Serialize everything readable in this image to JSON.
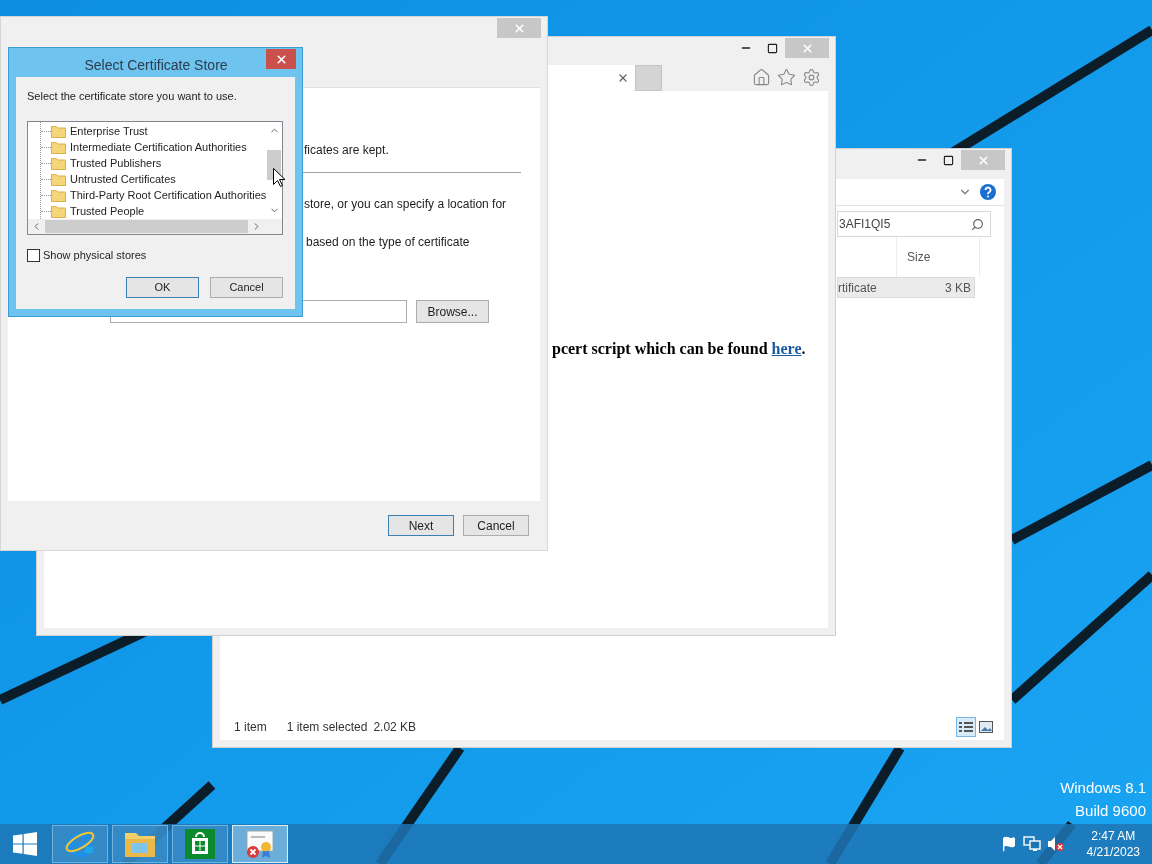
{
  "desktop": {
    "os_label": "Windows 8.1",
    "build_label": "Build 9600"
  },
  "explorer_window": {
    "search_value": "3AFI1QI5",
    "column_header": "Size",
    "files": [
      {
        "type": "rtificate",
        "size": "3 KB",
        "selected": true
      }
    ],
    "status_count": "1 item",
    "status_selection": "1 item selected",
    "status_size": "2.02 KB",
    "views": [
      {
        "kind": "details",
        "selected": true
      },
      {
        "kind": "large_icons",
        "selected": false
      }
    ]
  },
  "browser_window": {
    "text": "pcert script which can be found ",
    "link": "here",
    "text_end": "."
  },
  "wizard_window": {
    "lines": [
      "ficates are kept.",
      "store, or you can specify a location for",
      "based on the type of certificate"
    ],
    "browse_button": "Browse...",
    "buttons": [
      "Next",
      "Cancel"
    ]
  },
  "dialog": {
    "title": "Select Certificate Store",
    "prompt": "Select the certificate store you want to use.",
    "stores": [
      "Enterprise Trust",
      "Intermediate Certification Authorities",
      "Trusted Publishers",
      "Untrusted Certificates",
      "Third-Party Root Certification Authorities",
      "Trusted People"
    ],
    "show_physical_stores": {
      "label": "Show physical stores",
      "checked": false
    },
    "buttons": [
      "OK",
      "Cancel"
    ]
  },
  "taskbar": {
    "apps": [
      {
        "kind": "internet_explorer",
        "selected": false
      },
      {
        "kind": "file_explorer",
        "selected": false
      },
      {
        "kind": "store",
        "selected": false
      },
      {
        "kind": "certificate",
        "selected": true
      }
    ],
    "clock_time": "2:47 AM",
    "clock_date": "4/21/2023"
  }
}
